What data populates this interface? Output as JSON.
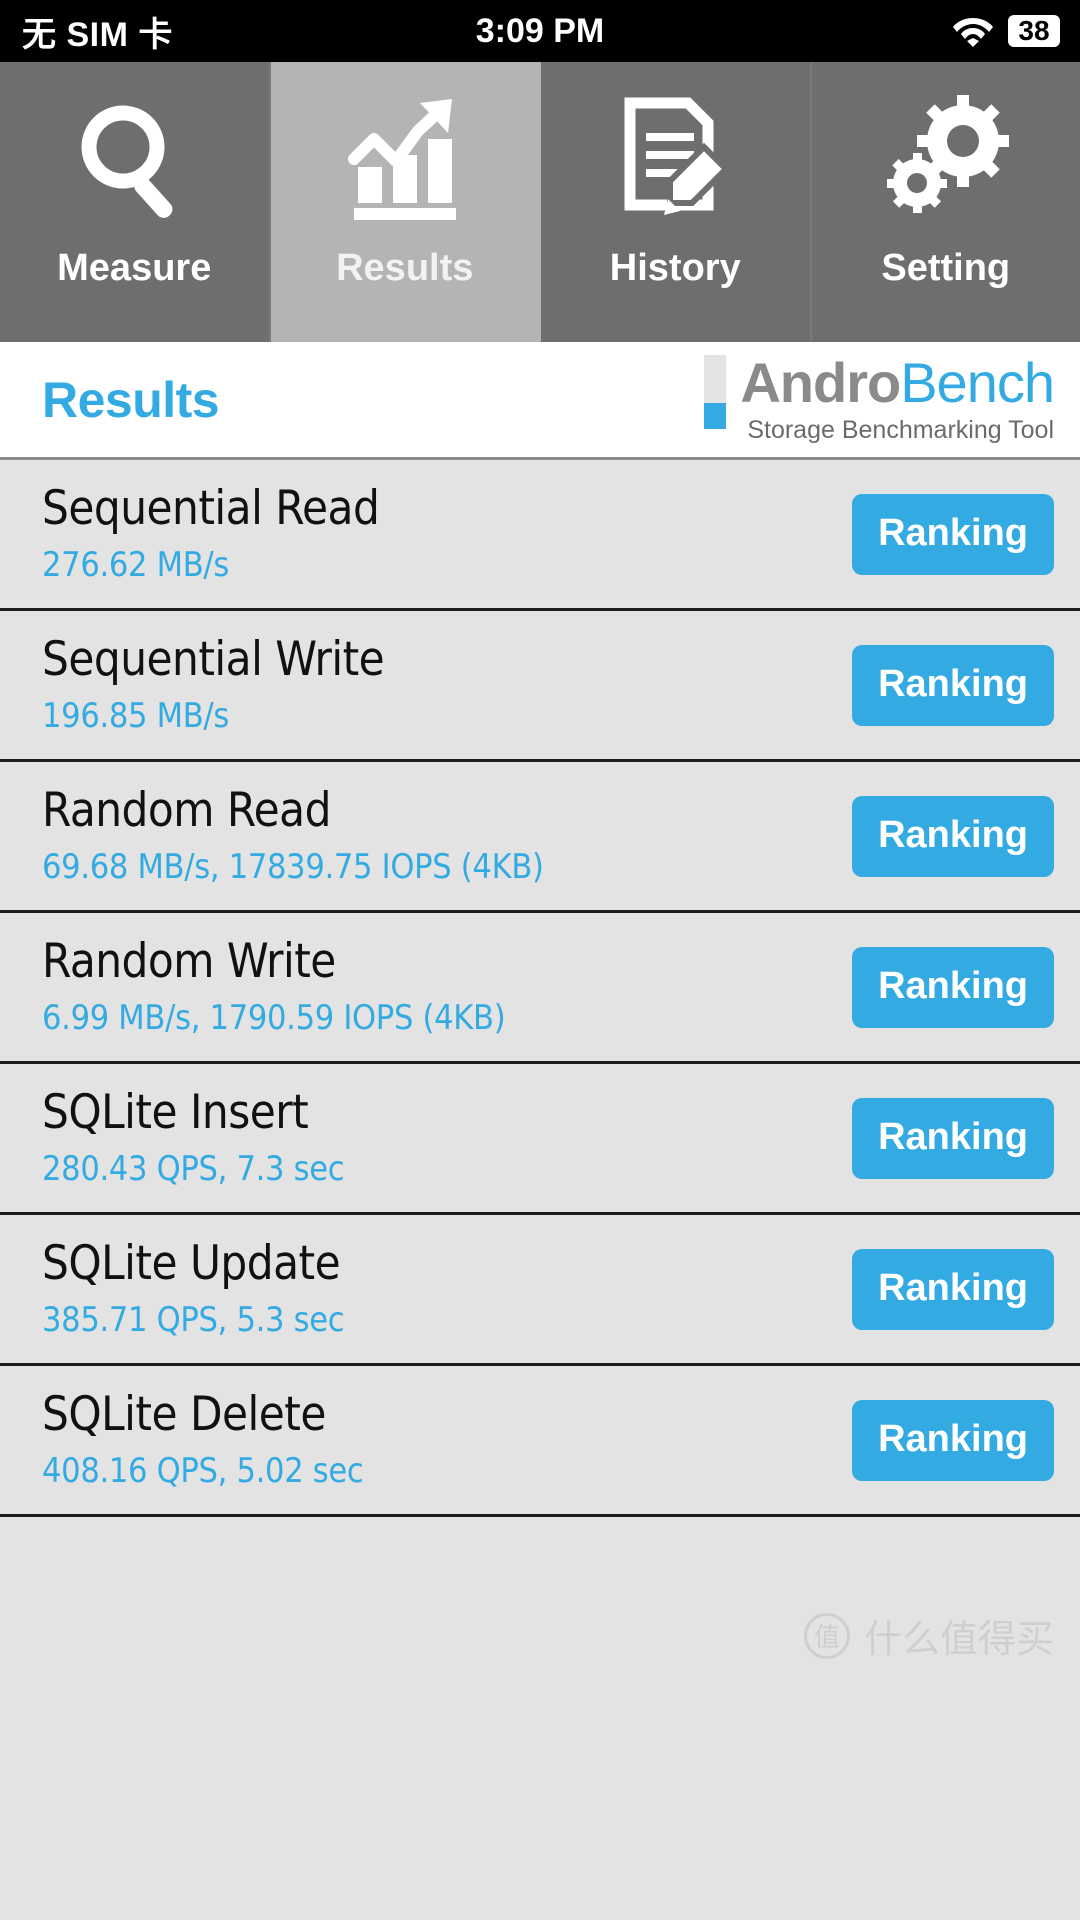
{
  "statusbar": {
    "carrier": "无 SIM 卡",
    "time": "3:09 PM",
    "wifi_icon": "wifi-icon",
    "battery_level": "38"
  },
  "tabs": [
    {
      "label": "Measure",
      "icon": "magnifier-icon",
      "active": false
    },
    {
      "label": "Results",
      "icon": "bar-chart-arrow-icon",
      "active": true
    },
    {
      "label": "History",
      "icon": "document-pencil-icon",
      "active": false
    },
    {
      "label": "Setting",
      "icon": "gears-icon",
      "active": false
    }
  ],
  "header": {
    "page_title": "Results",
    "brand_primary": "Andro",
    "brand_secondary": "Bench",
    "brand_subtitle": "Storage Benchmarking Tool"
  },
  "results": {
    "ranking_label": "Ranking",
    "rows": [
      {
        "title": "Sequential Read",
        "value": "276.62 MB/s"
      },
      {
        "title": "Sequential Write",
        "value": "196.85 MB/s"
      },
      {
        "title": "Random Read",
        "value": "69.68 MB/s, 17839.75 IOPS (4KB)"
      },
      {
        "title": "Random Write",
        "value": "6.99 MB/s, 1790.59 IOPS (4KB)"
      },
      {
        "title": "SQLite Insert",
        "value": "280.43 QPS, 7.3 sec"
      },
      {
        "title": "SQLite Update",
        "value": "385.71 QPS, 5.3 sec"
      },
      {
        "title": "SQLite Delete",
        "value": "408.16 QPS, 5.02 sec"
      }
    ]
  },
  "watermark": {
    "mark": "值",
    "text": "什么值得买"
  },
  "colors": {
    "accent_blue": "#33abe2",
    "tab_inactive": "#6e6e6e",
    "tab_active": "#b4b4b4",
    "list_background": "#e3e3e3",
    "row_divider": "#1c1c1c"
  }
}
